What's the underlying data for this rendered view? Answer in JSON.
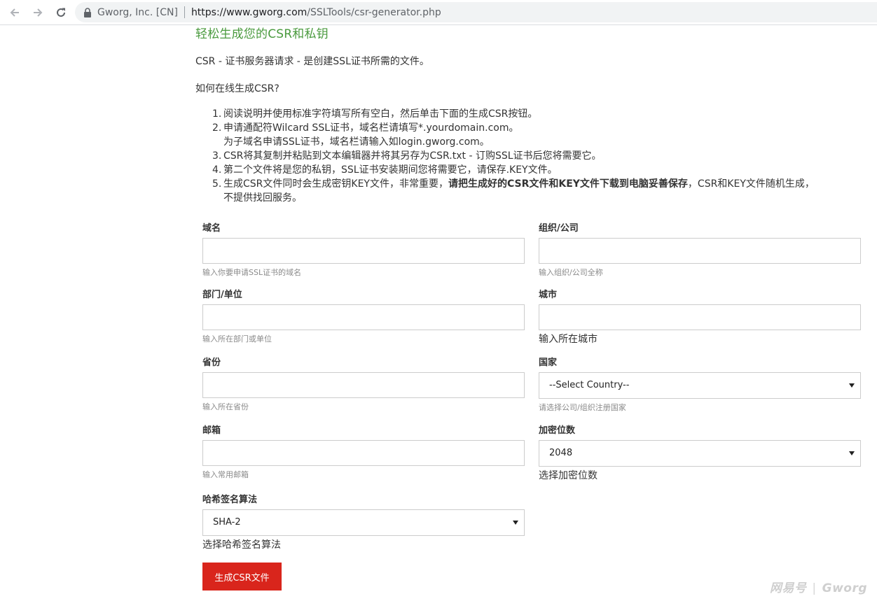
{
  "browser": {
    "site_identity": "Gworg, Inc. [CN]",
    "url_host": "https://www.gworg.com",
    "url_path": "/SSLTools/csr-generator.php"
  },
  "page": {
    "heading": "轻松生成您的CSR和私钥",
    "intro": "CSR - 证书服务器请求 - 是创建SSL证书所需的文件。",
    "howto": "如何在线生成CSR?",
    "steps": [
      {
        "num": "1.",
        "lines": [
          "阅读说明并使用标准字符填写所有空白，然后单击下面的生成CSR按钮。"
        ]
      },
      {
        "num": "2.",
        "lines": [
          "申请通配符Wilcard SSL证书，域名栏请填写*.yourdomain.com。",
          "为子域名申请SSL证书，域名栏请输入如login.gworg.com。"
        ]
      },
      {
        "num": "3.",
        "lines": [
          "CSR将其复制并粘贴到文本编辑器并将其另存为CSR.txt - 订购SSL证书后您将需要它。"
        ]
      },
      {
        "num": "4.",
        "lines": [
          "第二个文件将是您的私钥，SSL证书安装期间您将需要它，请保存.KEY文件。"
        ]
      },
      {
        "num": "5.",
        "prefix": "生成CSR文件同时会生成密钥KEY文件，非常重要，",
        "bold": "请把生成好的CSR文件和KEY文件下载到电脑妥善保存",
        "suffix": "，CSR和KEY文件随机生成，",
        "line2": "不提供找回服务。"
      }
    ]
  },
  "form": {
    "domain": {
      "label": "域名",
      "value": "",
      "help": "输入你要申请SSL证书的域名"
    },
    "organization": {
      "label": "组织/公司",
      "value": "",
      "help": "输入组织/公司全称"
    },
    "department": {
      "label": "部门/单位",
      "value": "",
      "help": "输入所在部门或单位"
    },
    "city": {
      "label": "城市",
      "value": "",
      "help": "输入所在城市"
    },
    "province": {
      "label": "省份",
      "value": "",
      "help": "输入所在省份"
    },
    "country": {
      "label": "国家",
      "selected": "--Select Country--",
      "help": "请选择公司/组织注册国家"
    },
    "email": {
      "label": "邮箱",
      "value": "",
      "help": "输入常用邮箱"
    },
    "key_size": {
      "label": "加密位数",
      "selected": "2048",
      "help": "选择加密位数"
    },
    "hash": {
      "label": "哈希签名算法",
      "selected": "SHA-2",
      "help": "选择哈希签名算法"
    },
    "submit_label": "生成CSR文件"
  },
  "watermark": {
    "left": "网易号",
    "right": "Gworg"
  },
  "icons": [
    "back-arrow-icon",
    "forward-arrow-icon",
    "reload-icon",
    "lock-icon",
    "chevron-down-icon"
  ]
}
